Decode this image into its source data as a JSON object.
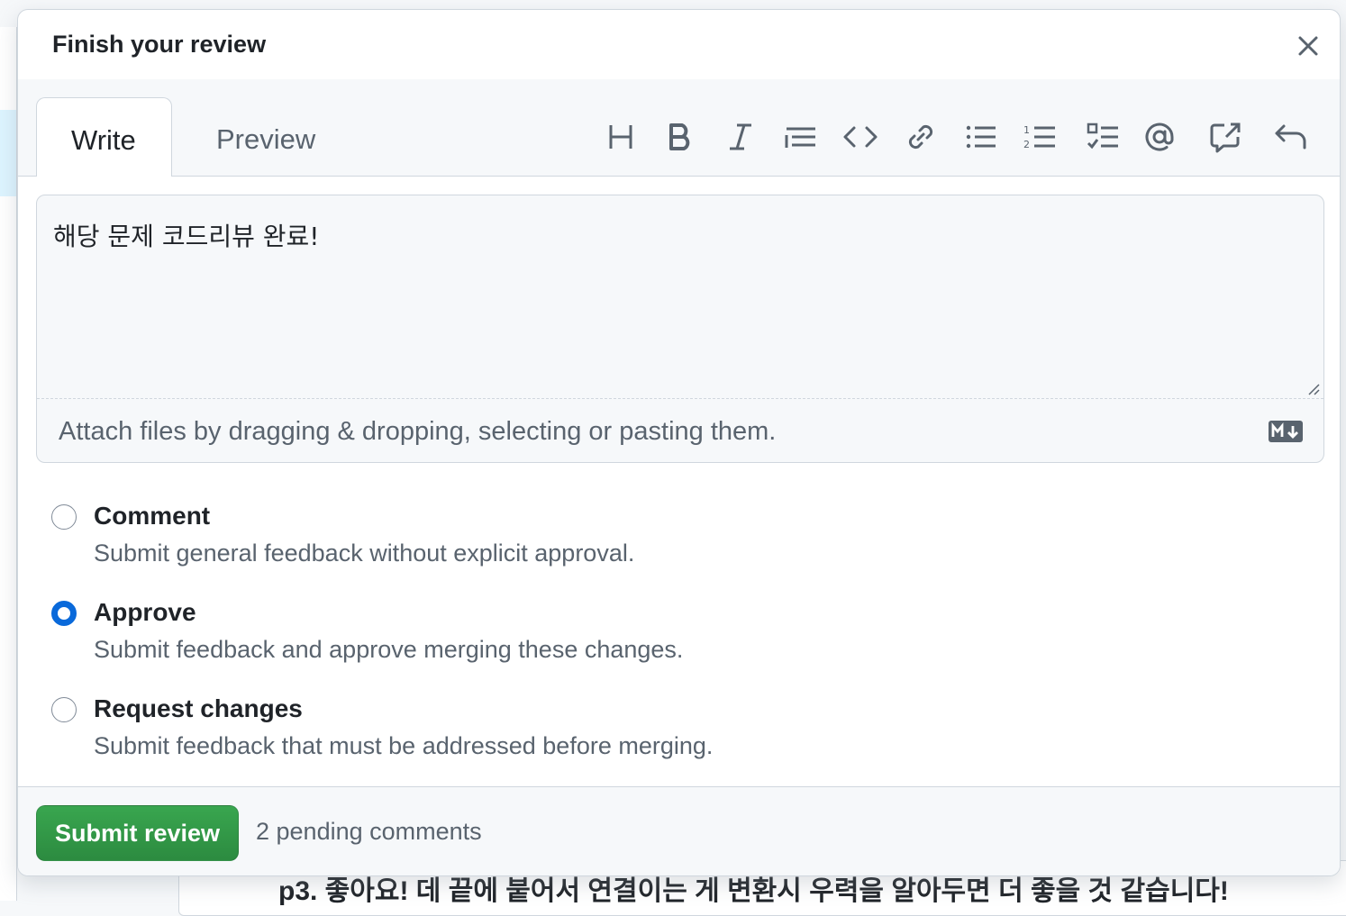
{
  "background": {
    "comment_snippet": "p3. 좋아요! 데 끝에 붙어서 연결이는 게 변환시 우력을 알아두면 더 좋을 것 같습니다!"
  },
  "dialog": {
    "title": "Finish your review",
    "close_icon": "close-icon"
  },
  "tabs": {
    "write": "Write",
    "preview": "Preview"
  },
  "toolbar": {
    "icons": [
      "heading-icon",
      "bold-icon",
      "italic-icon",
      "quote-icon",
      "code-icon",
      "link-icon",
      "unordered-list-icon",
      "ordered-list-icon",
      "task-list-icon",
      "mention-icon",
      "cross-reference-icon",
      "undo-icon"
    ]
  },
  "editor": {
    "value": "해당 문제 코드리뷰 완료!",
    "attach_hint": "Attach files by dragging & dropping, selecting or pasting them.",
    "markdown_icon": "markdown-icon"
  },
  "review_options": [
    {
      "label": "Comment",
      "description": "Submit general feedback without explicit approval.",
      "checked": false
    },
    {
      "label": "Approve",
      "description": "Submit feedback and approve merging these changes.",
      "checked": true
    },
    {
      "label": "Request changes",
      "description": "Submit feedback that must be addressed before merging.",
      "checked": false
    }
  ],
  "footer": {
    "submit_label": "Submit review",
    "pending": "2 pending comments"
  },
  "colors": {
    "accent": "#0969da",
    "submit_green": "#2da44e",
    "border": "#d0d7de",
    "muted_text": "#59636e"
  }
}
